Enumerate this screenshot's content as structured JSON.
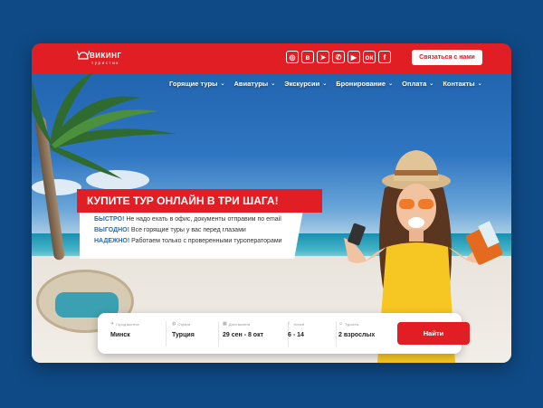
{
  "header": {
    "logo_brand": "ВИКИНГ",
    "logo_sub": "туристик",
    "contact_button": "Связаться с нами",
    "socials": [
      {
        "icon": "instagram-icon",
        "glyph": "◎"
      },
      {
        "icon": "vk-icon",
        "glyph": "в"
      },
      {
        "icon": "telegram-icon",
        "glyph": "➤"
      },
      {
        "icon": "viber-icon",
        "glyph": "✆"
      },
      {
        "icon": "youtube-icon",
        "glyph": "▶"
      },
      {
        "icon": "odnoklassniki-icon",
        "glyph": "ок"
      },
      {
        "icon": "facebook-icon",
        "glyph": "f"
      }
    ]
  },
  "nav": {
    "items": [
      {
        "label": "Горящие туры"
      },
      {
        "label": "Авиатуры"
      },
      {
        "label": "Экскурсии"
      },
      {
        "label": "Бронирование"
      },
      {
        "label": "Оплата"
      },
      {
        "label": "Контакты"
      }
    ]
  },
  "hero": {
    "headline": "КУПИТЕ ТУР ОНЛАЙН В ТРИ ШАГА!",
    "points": [
      {
        "bold": "БЫСТРО!",
        "text": " Не надо ехать в офис, документы отправим по email"
      },
      {
        "bold": "ВЫГОДНО!",
        "text": " Все горящие туры у вас перед глазами"
      },
      {
        "bold": "НАДЕЖНО!",
        "text": " Работаем только с проверенными туроператорами"
      }
    ]
  },
  "search": {
    "fields": [
      {
        "label": "Город вылета",
        "value": "Минск",
        "icon": "plane-icon"
      },
      {
        "label": "Страна",
        "value": "Турция",
        "icon": "globe-icon"
      },
      {
        "label": "Дата вылета",
        "value": "29 сен - 8 окт",
        "icon": "calendar-icon"
      },
      {
        "label": "Ночей",
        "value": "6 - 14",
        "icon": "moon-icon"
      },
      {
        "label": "Туристы",
        "value": "2 взрослых",
        "icon": "user-icon"
      }
    ],
    "button": "Найти"
  },
  "colors": {
    "brand_red": "#e01e24",
    "page_bg": "#0f4a86",
    "accent_blue": "#1f6fbf"
  }
}
